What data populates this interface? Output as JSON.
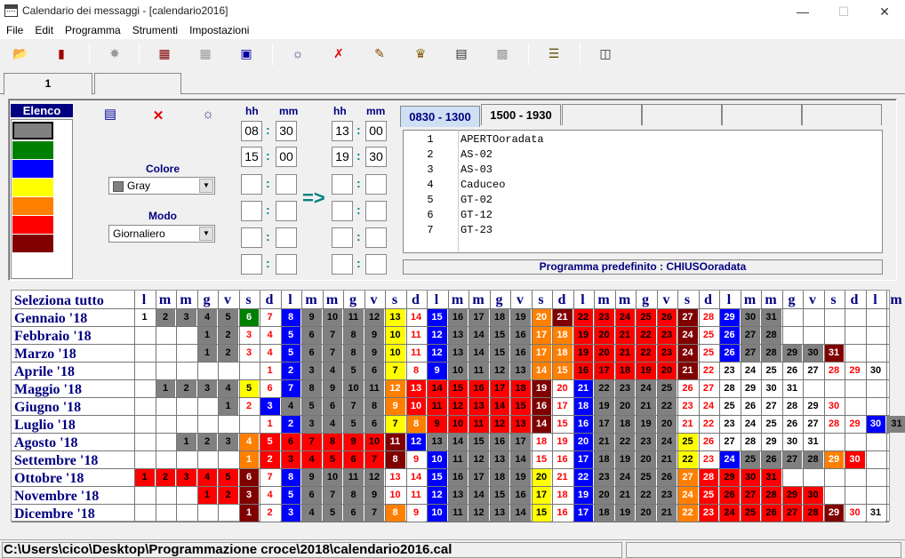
{
  "window": {
    "title": "Calendario dei messaggi - [calendario2016]",
    "minimize": "—",
    "maximize": "☐",
    "close": "✕"
  },
  "menu": [
    "File",
    "Edit",
    "Programma",
    "Strumenti",
    "Impostazioni"
  ],
  "toolbar_icons": [
    "open-folder-icon",
    "book-icon",
    "wand-icon",
    "document-copy-icon",
    "document-disabled-icon",
    "palette-icon",
    "globe-icon",
    "delete-x-icon",
    "pen-icon",
    "stamp-icon",
    "save-disk-icon",
    "print-icon",
    "notes-icon",
    "calendar-icon"
  ],
  "tabs": [
    "1",
    ""
  ],
  "elenco": {
    "title": "Elenco",
    "colors": [
      "#808080",
      "#008000",
      "#0000ff",
      "#ffff00",
      "#ff8000",
      "#ff0000",
      "#800000"
    ]
  },
  "colore": {
    "label": "Colore",
    "value": "Gray"
  },
  "modo": {
    "label": "Modo",
    "value": "Giornaliero"
  },
  "times": {
    "hh": "hh",
    "mm": "mm",
    "left": [
      [
        "08",
        "30"
      ],
      [
        "15",
        "00"
      ],
      [
        "",
        ""
      ],
      [
        "",
        ""
      ],
      [
        "",
        ""
      ],
      [
        "",
        ""
      ]
    ],
    "right": [
      [
        "13",
        "00"
      ],
      [
        "19",
        "30"
      ],
      [
        "",
        ""
      ],
      [
        "",
        ""
      ],
      [
        "",
        ""
      ],
      [
        "",
        ""
      ]
    ],
    "arrow": "=>"
  },
  "period_tabs": [
    "0830 - 1300",
    "1500 - 1930",
    "",
    "",
    "",
    ""
  ],
  "program_list": [
    {
      "n": "1",
      "t": "APERTOoradata"
    },
    {
      "n": "2",
      "t": "AS-02"
    },
    {
      "n": "3",
      "t": "AS-03"
    },
    {
      "n": "4",
      "t": "Caduceo"
    },
    {
      "n": "5",
      "t": "GT-02"
    },
    {
      "n": "6",
      "t": "GT-12"
    },
    {
      "n": "7",
      "t": "GT-23"
    }
  ],
  "programma_predefinito": "Programma predefinito : CHIUSOoradata",
  "calendar": {
    "select_all": "Seleziona tutto",
    "day_headers": [
      "l",
      "m",
      "m",
      "g",
      "v",
      "s",
      "d",
      "l",
      "m",
      "m",
      "g",
      "v",
      "s",
      "d",
      "l",
      "m",
      "m",
      "g",
      "v",
      "s",
      "d",
      "l",
      "m",
      "m",
      "g",
      "v",
      "s",
      "d",
      "l",
      "m",
      "m",
      "g",
      "v",
      "s",
      "d",
      "l",
      "m"
    ],
    "months": [
      "Gennaio '18",
      "Febbraio '18",
      "Marzo '18",
      "Aprile '18",
      "Maggio '18",
      "Giugno '18",
      "Luglio '18",
      "Agosto '18",
      "Settembre '18",
      "Ottobre '18",
      "Novembre '18",
      "Dicembre '18"
    ],
    "rows": [
      "1:W,2:G,3:G,4:G,5:G,6:N,7:W,8:B,9:G,10:G,11:G,12:G,13:Y,14:W,15:B,16:G,17:G,18:G,19:G,20:O,21:M,22:R,23:R,24:R,25:R,26:R,27:M,28:W,29:B,30:G,31:G",
      ",,,1:G,2:G,3:W,4:W,5:B,6:G,7:G,8:G,9:G,10:Y,11:W,12:B,13:G,14:G,15:G,16:G,17:O,18:O,19:R,20:R,21:R,22:R,23:R,24:M,25:W,26:B,27:G,28:G",
      ",,,1:G,2:G,3:W,4:W,5:B,6:G,7:G,8:G,9:G,10:Y,11:W,12:B,13:G,14:G,15:G,16:G,17:O,18:O,19:R,20:R,21:R,22:R,23:R,24:M,25:W,26:B,27:G,28:G,29:G,30:G,31:M",
      ",,,,,,1:W,2:B,3:G,4:G,5:G,6:G,7:Y,8:W,9:B,10:G,11:G,12:G,13:G,14:O,15:O,16:R,17:R,18:R,19:R,20:R,21:M,22:W,23:W,24:W,25:W,26:W,27:W,28:W,29:W,30:W",
      ",1:G,2:G,3:G,4:G,5:Y,6:W,7:B,8:G,9:G,10:G,11:G,12:O,13:R,14:R,15:R,16:R,17:R,18:R,19:M,20:W,21:B,22:G,23:G,24:G,25:G,26:W,27:W,28:W,29:W,30:W,31:W",
      ",,,,1:G,2:W,3:B,4:G,5:G,6:G,7:G,8:G,9:O,10:R,11:R,12:R,13:R,14:R,15:R,16:M,17:W,18:B,19:G,20:G,21:G,22:G,23:W,24:W,25:W,26:W,27:W,28:W,29:W,30:W",
      ",,,,,,1:W,2:B,3:G,4:G,5:G,6:G,7:Y,8:O,9:R,10:R,11:R,12:R,13:R,14:M,15:W,16:B,17:G,18:G,19:G,20:G,21:W,22:W,23:W,24:W,25:W,26:W,27:W,28:W,29:W,30:B,31:G",
      ",,1:G,2:G,3:G,4:O,5:R,6:R,7:R,8:R,9:R,10:R,11:M,12:B,13:G,14:G,15:G,16:G,17:G,18:W,19:W,20:B,21:G,22:G,23:G,24:G,25:Y,26:W,27:W,28:W,29:W,30:W,31:W",
      ",,,,,1:O,2:R,3:R,4:R,5:R,6:R,7:R,8:M,9:W,10:B,11:G,12:G,13:G,14:G,15:W,16:W,17:B,18:G,19:G,20:G,21:G,22:Y,23:W,24:B,25:G,26:G,27:G,28:G,29:O,30:R",
      "1:R,2:R,3:R,4:R,5:R,6:M,7:W,8:B,9:G,10:G,11:G,12:G,13:W,14:W,15:B,16:G,17:G,18:G,19:G,20:Y,21:W,22:B,23:G,24:G,25:G,26:G,27:O,28:R,29:R,30:R,31:R",
      ",,,1:R,2:R,3:M,4:W,5:B,6:G,7:G,8:G,9:G,10:W,11:W,12:B,13:G,14:G,15:G,16:G,17:Y,18:W,19:B,20:G,21:G,22:G,23:G,24:O,25:R,26:R,27:R,28:R,29:R,30:R",
      ",,,,,1:M,2:W,3:B,4:G,5:G,6:G,7:G,8:O,9:W,10:B,11:G,12:G,13:G,14:G,15:Y,16:W,17:B,18:G,19:G,20:G,21:G,22:O,23:R,24:R,25:R,26:R,27:R,28:R,29:M,30:W,31:W"
    ],
    "palette": {
      "W": "#ffffff",
      "G": "#808080",
      "B": "#0000ff",
      "Y": "#ffff00",
      "O": "#ff8000",
      "R": "#ff0000",
      "M": "#800000",
      "N": "#008000"
    }
  },
  "status": {
    "path": "C:\\Users\\cico\\Desktop\\Programmazione croce\\2018\\calendario2016.cal",
    "right": ""
  }
}
